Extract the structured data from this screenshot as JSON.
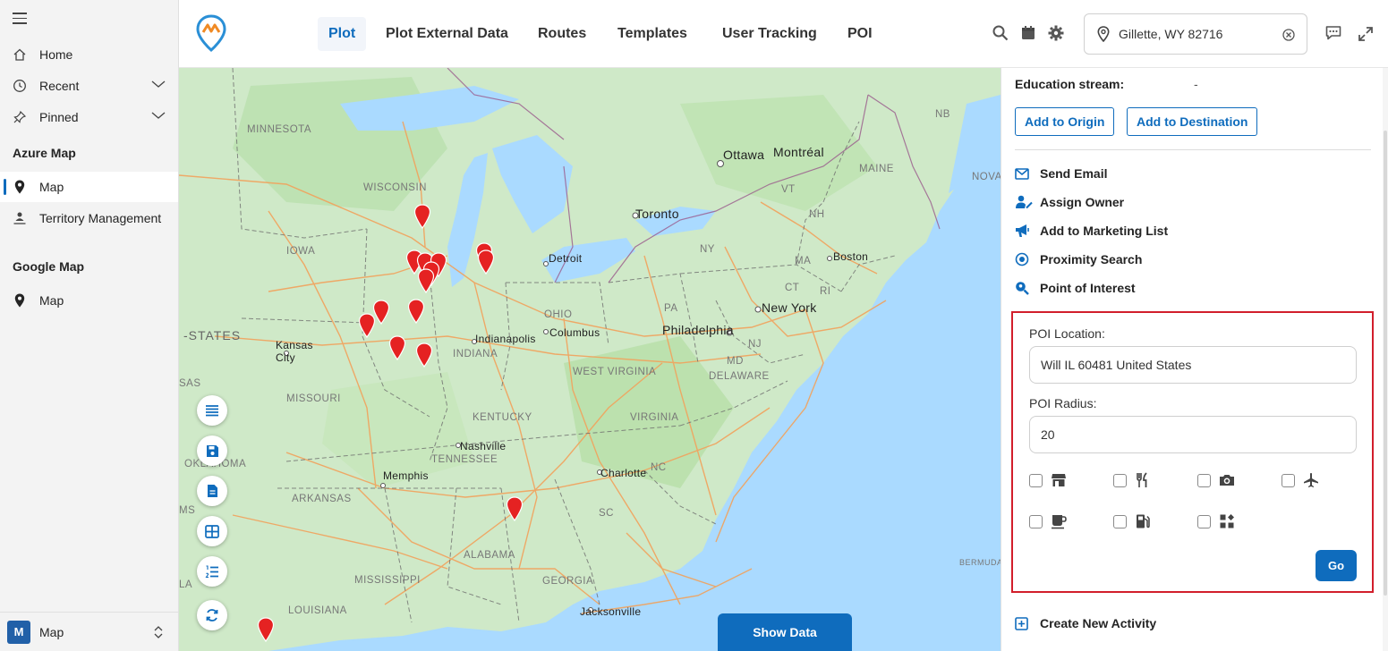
{
  "sidebar": {
    "items": [
      {
        "label": "Home",
        "icon": "home-icon"
      },
      {
        "label": "Recent",
        "icon": "clock-icon"
      },
      {
        "label": "Pinned",
        "icon": "pin-icon"
      }
    ],
    "sections": [
      {
        "title": "Azure Map",
        "items": [
          {
            "label": "Map",
            "icon": "map-marker-icon"
          },
          {
            "label": "Territory Management",
            "icon": "territory-icon"
          }
        ]
      },
      {
        "title": "Google Map",
        "items": [
          {
            "label": "Map",
            "icon": "map-marker-icon"
          }
        ]
      }
    ],
    "area": {
      "badge": "M",
      "label": "Map"
    }
  },
  "topbar": {
    "tabs": [
      "Plot",
      "Plot External Data",
      "Routes",
      "Templates",
      "User Tracking",
      "POI"
    ],
    "active_tab": "Plot",
    "location": "Gillette, WY 82716"
  },
  "map": {
    "labels": [
      {
        "text": "MINNESOTA",
        "kind": "state"
      },
      {
        "text": "WISCONSIN",
        "kind": "state"
      },
      {
        "text": "IOWA",
        "kind": "state"
      },
      {
        "text": "-STATES",
        "kind": "big"
      },
      {
        "text": "Kansas",
        "kind": "city"
      },
      {
        "text": "City",
        "kind": "city"
      },
      {
        "text": "SAS",
        "kind": "state"
      },
      {
        "text": "MISSOURI",
        "kind": "state"
      },
      {
        "text": "OKLAHOMA",
        "kind": "state"
      },
      {
        "text": "ARKANSAS",
        "kind": "state"
      },
      {
        "text": "Memphis",
        "kind": "city"
      },
      {
        "text": "MISSISSIPPI",
        "kind": "state"
      },
      {
        "text": "LOUISIANA",
        "kind": "state"
      },
      {
        "text": "ALABAMA",
        "kind": "state"
      },
      {
        "text": "GEORGIA",
        "kind": "state"
      },
      {
        "text": "TENNESSEE",
        "kind": "state"
      },
      {
        "text": "Nashville",
        "kind": "city"
      },
      {
        "text": "KENTUCKY",
        "kind": "state"
      },
      {
        "text": "INDIANA",
        "kind": "state"
      },
      {
        "text": "Indianapolis",
        "kind": "city"
      },
      {
        "text": "OHIO",
        "kind": "state"
      },
      {
        "text": "Columbus",
        "kind": "city"
      },
      {
        "text": "WEST VIRGINIA",
        "kind": "state"
      },
      {
        "text": "VIRGINIA",
        "kind": "state"
      },
      {
        "text": "NC",
        "kind": "state"
      },
      {
        "text": "SC",
        "kind": "state"
      },
      {
        "text": "Charlotte",
        "kind": "city"
      },
      {
        "text": "Jacksonville",
        "kind": "city"
      },
      {
        "text": "Detroit",
        "kind": "city"
      },
      {
        "text": "Toronto",
        "kind": "big"
      },
      {
        "text": "Ottawa",
        "kind": "big"
      },
      {
        "text": "Montréal",
        "kind": "big"
      },
      {
        "text": "NY",
        "kind": "state"
      },
      {
        "text": "PA",
        "kind": "state"
      },
      {
        "text": "Philadelphia",
        "kind": "big"
      },
      {
        "text": "New York",
        "kind": "big"
      },
      {
        "text": "NJ",
        "kind": "state"
      },
      {
        "text": "MD",
        "kind": "state"
      },
      {
        "text": "DELAWARE",
        "kind": "state"
      },
      {
        "text": "VT",
        "kind": "state"
      },
      {
        "text": "NH",
        "kind": "state"
      },
      {
        "text": "MA",
        "kind": "state"
      },
      {
        "text": "CT",
        "kind": "state"
      },
      {
        "text": "RI",
        "kind": "state"
      },
      {
        "text": "Boston",
        "kind": "city"
      },
      {
        "text": "MAINE",
        "kind": "state"
      },
      {
        "text": "NB",
        "kind": "state"
      },
      {
        "text": "NOVA",
        "kind": "state"
      },
      {
        "text": "BERMUDA",
        "kind": "state"
      },
      {
        "text": "LA",
        "kind": "state"
      },
      {
        "text": "MS",
        "kind": "state"
      }
    ],
    "show_data_label": "Show Data",
    "tools": [
      "list-icon",
      "save-icon",
      "document-icon",
      "grid-icon",
      "numbered-list-icon",
      "refresh-icon"
    ]
  },
  "panel": {
    "education_label": "Education stream:",
    "education_value": "-",
    "add_origin": "Add to Origin",
    "add_destination": "Add to Destination",
    "actions": [
      {
        "label": "Send Email",
        "icon": "envelope-icon"
      },
      {
        "label": "Assign Owner",
        "icon": "assign-user-icon"
      },
      {
        "label": "Add to Marketing List",
        "icon": "megaphone-icon"
      },
      {
        "label": "Proximity Search",
        "icon": "target-icon"
      },
      {
        "label": "Point of Interest",
        "icon": "search-location-icon"
      }
    ],
    "poi": {
      "location_label": "POI Location:",
      "location_value": "Will IL 60481 United States",
      "radius_label": "POI Radius:",
      "radius_value": "20",
      "categories": [
        "store-icon",
        "restaurant-icon",
        "camera-icon",
        "airplane-icon",
        "cafe-icon",
        "gas-station-icon",
        "other-category-icon"
      ],
      "go_label": "Go"
    },
    "create_activity": "Create New Activity"
  },
  "colors": {
    "accent": "#0f6cbd",
    "highlight_border": "#d21e2b",
    "marker": "#e52222",
    "water": "#aadaff",
    "land": "#cfe9c8"
  }
}
